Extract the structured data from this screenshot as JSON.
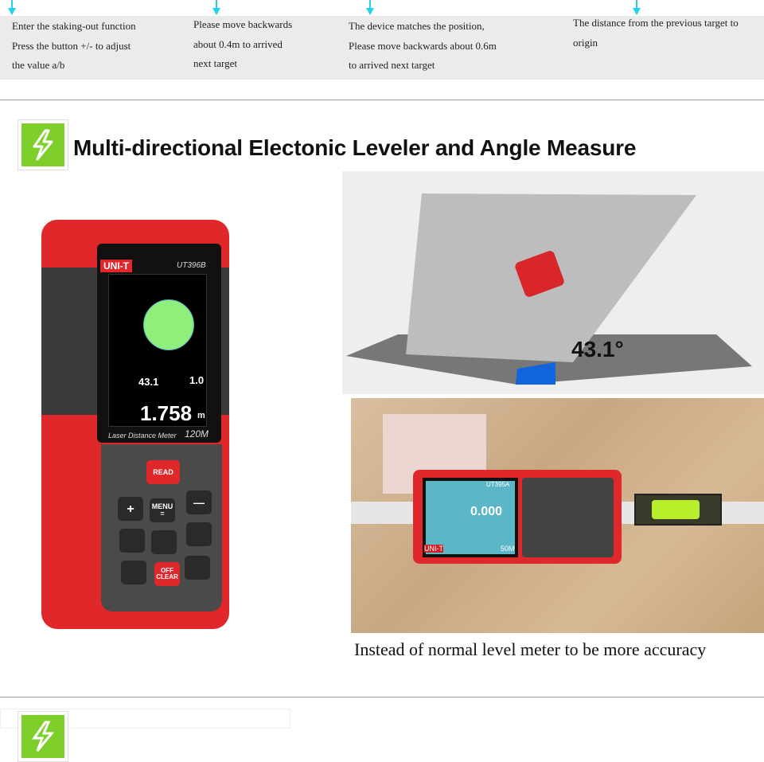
{
  "steps": [
    {
      "lines": [
        "Enter the staking-out function",
        "Press the button +/- to adjust",
        "the value a/b"
      ]
    },
    {
      "lines": [
        "Please move backwards",
        "about 0.4m to arrived",
        "next target"
      ]
    },
    {
      "lines": [
        "The device matches the position,",
        "Please move backwards about 0.6m",
        "to arrived next target"
      ]
    },
    {
      "lines": [
        "The distance from the previous target to",
        "origin"
      ]
    }
  ],
  "section": {
    "title": "Multi-directional Electonic Leveler and Angle Measure",
    "icon": "lightning-icon",
    "icon_color": "#7fcf2a"
  },
  "device": {
    "brand": "UNI-T",
    "model": "UT396B",
    "angle1": "43.1",
    "angle2": "1.0",
    "degree": "°",
    "distance": "1.758",
    "unit": "m",
    "label": "Laser Distance Meter",
    "range": "120M",
    "keys": {
      "read": "READ",
      "menu": "MENU",
      "eq": "=",
      "off": "OFF",
      "clear": "CLEAR",
      "plus": "+",
      "minus": "—"
    },
    "body_color": "#e0282b"
  },
  "scene": {
    "angle": "43.1°"
  },
  "photo": {
    "brand": "UNI-T",
    "model": "UT395A",
    "distance": "0.000",
    "range": "50M"
  },
  "caption": "Instead of normal level meter to be more accuracy"
}
